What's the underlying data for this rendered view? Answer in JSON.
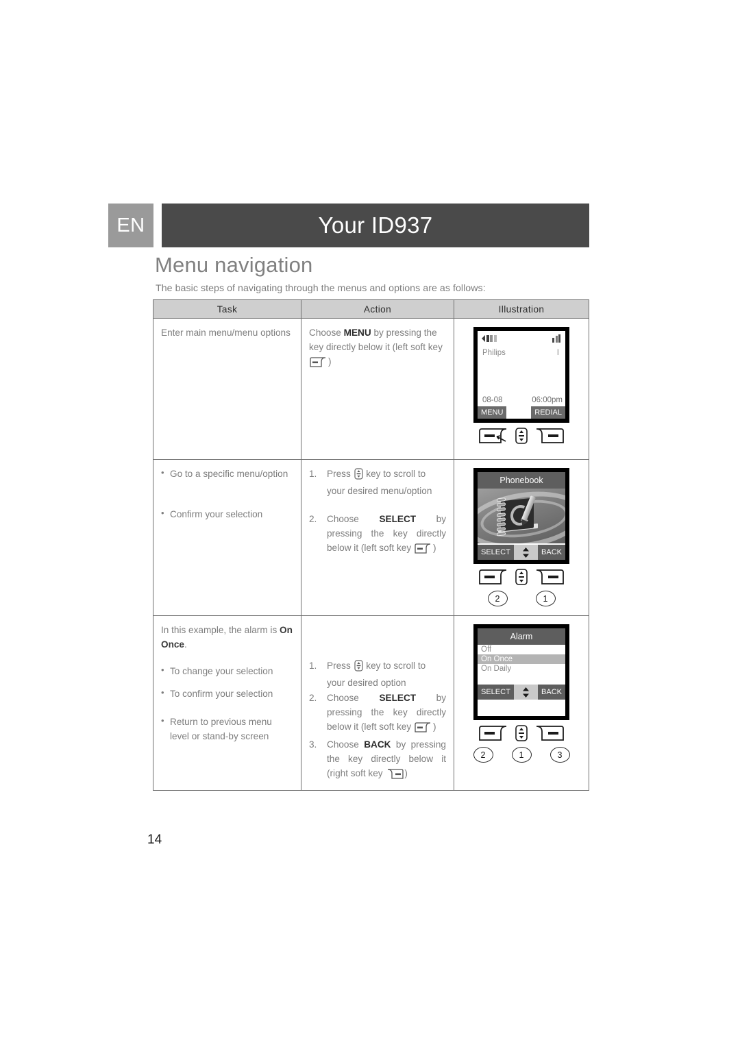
{
  "header": {
    "language_badge": "EN",
    "title": "Your ID937"
  },
  "section": {
    "heading": "Menu navigation",
    "intro": "The basic steps of navigating through the menus and options are as follows:"
  },
  "table": {
    "columns": [
      "Task",
      "Action",
      "Illustration"
    ],
    "rows": [
      {
        "task_text": "Enter main menu/menu options",
        "action_lines": [
          "Choose MENU by pressing the key",
          "directly below it (left soft key",
          ")"
        ],
        "action_bold": "MENU",
        "illustration": "standby-screen"
      },
      {
        "task_bullets": [
          "Go to a specific menu/option",
          "Confirm your selection"
        ],
        "steps": [
          {
            "num": "1.",
            "text": "Press  key to scroll to your desired menu/option"
          },
          {
            "num": "2.",
            "text": "Choose SELECT by pressing the key directly below it (left soft key )",
            "bold": "SELECT"
          }
        ],
        "illustration": "phonebook-screen"
      },
      {
        "task_intro": "In this example, the alarm is On Once.",
        "task_intro_bold": "On Once",
        "task_bullets": [
          "To change your selection",
          "To confirm your selection",
          "Return to previous menu level or stand-by screen"
        ],
        "steps": [
          {
            "num": "1.",
            "text": "Press  key to scroll to your desired option"
          },
          {
            "num": "2.",
            "text": "Choose SELECT by pressing the key directly below it (left soft key )",
            "bold": "SELECT"
          },
          {
            "num": "3.",
            "text": "Choose BACK by pressing the key directly below it (right soft key )",
            "bold": "BACK"
          }
        ],
        "illustration": "alarm-screen"
      }
    ]
  },
  "standby_screen": {
    "network_name": "Philips",
    "indicator": "I",
    "date": "08-08",
    "time": "06:00pm",
    "softkey_left": "MENU",
    "softkey_right": "REDIAL",
    "battery_icon": "battery-icon",
    "signal_icon": "signal-bars-icon"
  },
  "phonebook_screen": {
    "title": "Phonebook",
    "softkey_left": "SELECT",
    "softkey_right": "BACK",
    "scroll_icon": "up-down-arrow-icon",
    "callouts": [
      "2",
      "1"
    ]
  },
  "alarm_screen": {
    "title": "Alarm",
    "items": [
      "Off",
      "On Once",
      "On Daily"
    ],
    "selected_item": "On Once",
    "softkey_left": "SELECT",
    "softkey_right": "BACK",
    "scroll_icon": "up-down-arrow-icon",
    "callouts": [
      "2",
      "1",
      "3"
    ]
  },
  "standby_callouts": [],
  "page": {
    "number": "14"
  },
  "icons": {
    "left_soft_key": "left-soft-key-icon",
    "right_soft_key": "right-soft-key-icon",
    "scroll_key": "scroll-key-icon"
  },
  "colors": {
    "title_bar": "#4a4a4a",
    "lang_badge": "#9a9a9a",
    "table_header": "#cfcfcf",
    "text": "#7d7d7d",
    "screen_title_bar": "#5e5e5e",
    "selected_row": "#b4b4b4"
  }
}
